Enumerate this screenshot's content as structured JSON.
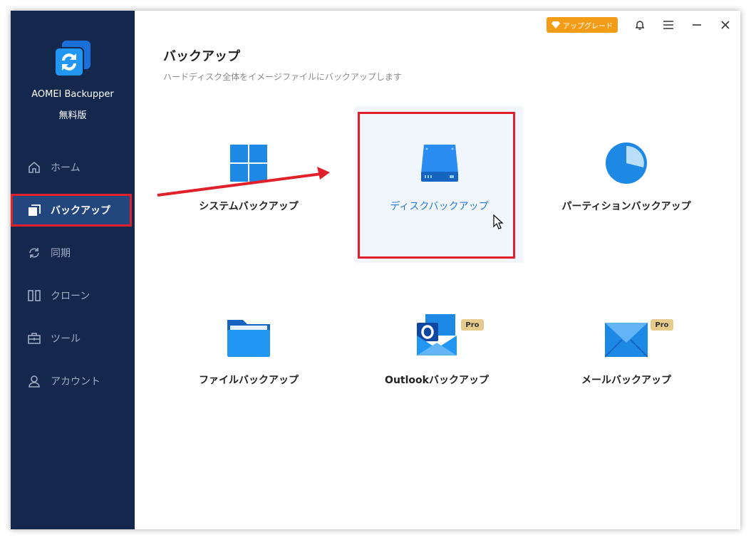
{
  "app": {
    "name": "AOMEI Backupper",
    "edition": "無料版",
    "logo_icon": "aomei-logo-icon"
  },
  "titlebar": {
    "upgrade_label": "アップグレード",
    "upgrade_icon": "diamond-icon",
    "bell_icon": "bell-icon",
    "menu_icon": "hamburger-menu-icon",
    "minimize_icon": "minimize-icon",
    "close_icon": "close-icon"
  },
  "sidebar": {
    "items": [
      {
        "label": "ホーム",
        "icon": "home-icon",
        "active": false
      },
      {
        "label": "バックアップ",
        "icon": "backup-icon",
        "active": true
      },
      {
        "label": "同期",
        "icon": "sync-icon",
        "active": false
      },
      {
        "label": "クローン",
        "icon": "clone-icon",
        "active": false
      },
      {
        "label": "ツール",
        "icon": "toolbox-icon",
        "active": false
      },
      {
        "label": "アカウント",
        "icon": "user-icon",
        "active": false
      }
    ]
  },
  "main": {
    "title": "バックアップ",
    "subtitle": "ハードディスク全体をイメージファイルにバックアップします",
    "tiles": [
      {
        "label": "システムバックアップ",
        "icon": "windows-logo-icon",
        "pro": false,
        "selected": false
      },
      {
        "label": "ディスクバックアップ",
        "icon": "hard-disk-icon",
        "pro": false,
        "selected": true
      },
      {
        "label": "パーティションバックアップ",
        "icon": "pie-chart-icon",
        "pro": false,
        "selected": false
      },
      {
        "label": "ファイルバックアップ",
        "icon": "folder-icon",
        "pro": false,
        "selected": false
      },
      {
        "label": "Outlookバックアップ",
        "icon": "outlook-icon",
        "pro": true,
        "selected": false
      },
      {
        "label": "メールバックアップ",
        "icon": "mail-envelope-icon",
        "pro": true,
        "selected": false
      }
    ],
    "pro_badge_label": "Pro"
  },
  "colors": {
    "sidebar_bg": "#14284d",
    "active_nav_bg": "#23467e",
    "annotation_red": "#e0202a",
    "upgrade_orange": "#f39c18",
    "icon_blue": "#1e88e5",
    "selected_text": "#2a7ad6"
  }
}
